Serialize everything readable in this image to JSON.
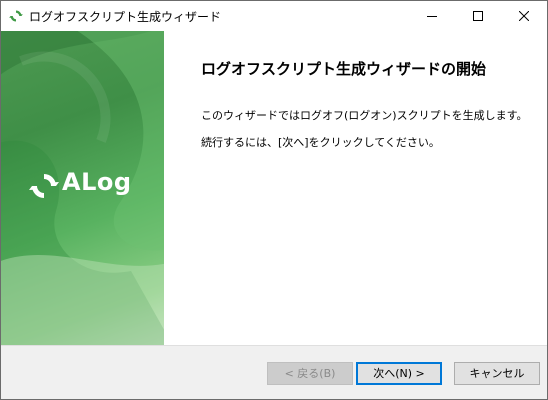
{
  "window": {
    "title": "ログオフスクリプト生成ウィザード",
    "controls": {
      "minimize": "minimize-icon",
      "maximize": "maximize-icon",
      "close": "close-icon"
    }
  },
  "banner": {
    "logo_text": "ALog",
    "colors": {
      "dark": "#3f8f47",
      "mid": "#58b260",
      "light": "#cfe8c9"
    }
  },
  "content": {
    "heading": "ログオフスクリプト生成ウィザードの開始",
    "paragraphs": [
      "このウィザードではログオフ(ログオン)スクリプトを生成します。",
      "続行するには、[次へ]をクリックしてください。"
    ]
  },
  "buttons": {
    "back": "< 戻る(B)",
    "next": "次へ(N) >",
    "cancel": "キャンセル"
  }
}
